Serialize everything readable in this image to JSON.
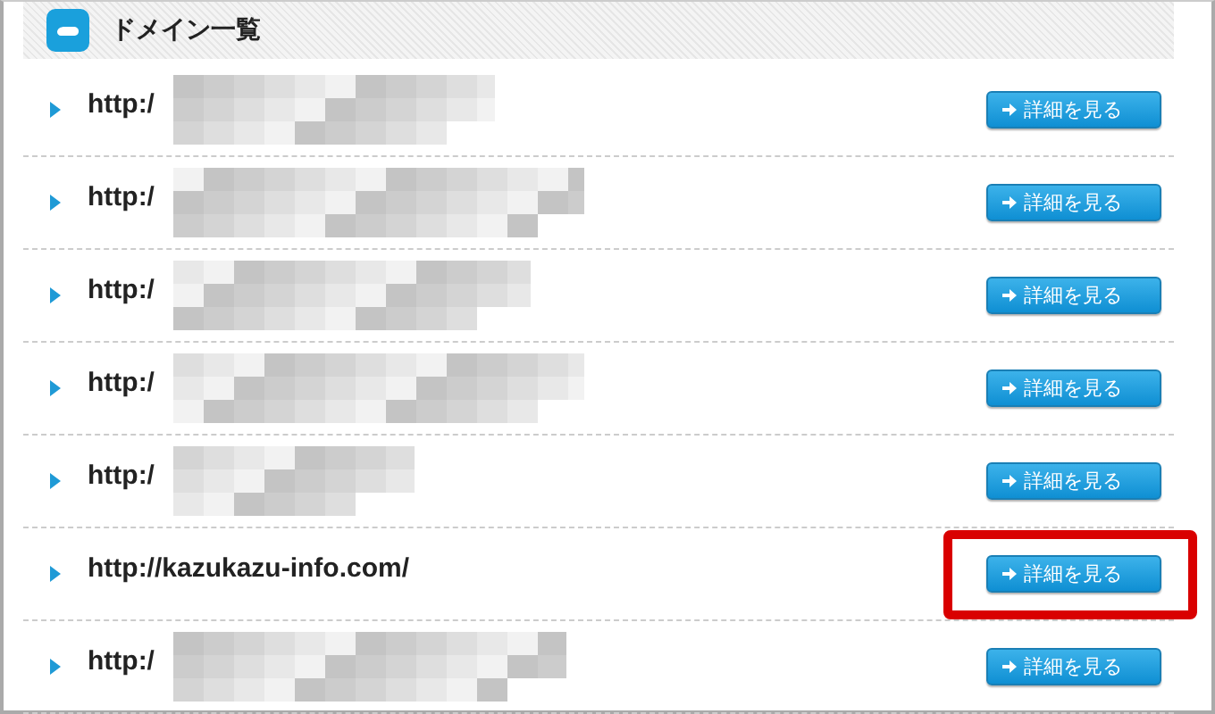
{
  "panel": {
    "title": "ドメイン一覧"
  },
  "domains": [
    {
      "url": "http:/",
      "redacted": true,
      "highlighted": false,
      "button": "詳細を見る"
    },
    {
      "url": "http:/",
      "redacted": true,
      "highlighted": false,
      "button": "詳細を見る"
    },
    {
      "url": "http:/",
      "redacted": true,
      "highlighted": false,
      "button": "詳細を見る"
    },
    {
      "url": "http:/",
      "redacted": true,
      "highlighted": false,
      "button": "詳細を見る"
    },
    {
      "url": "http:/",
      "redacted": true,
      "highlighted": false,
      "button": "詳細を見る"
    },
    {
      "url": "http://kazukazu-info.com/",
      "redacted": false,
      "highlighted": true,
      "button": "詳細を見る"
    },
    {
      "url": "http:/",
      "redacted": true,
      "highlighted": false,
      "button": "詳細を見る"
    }
  ]
}
